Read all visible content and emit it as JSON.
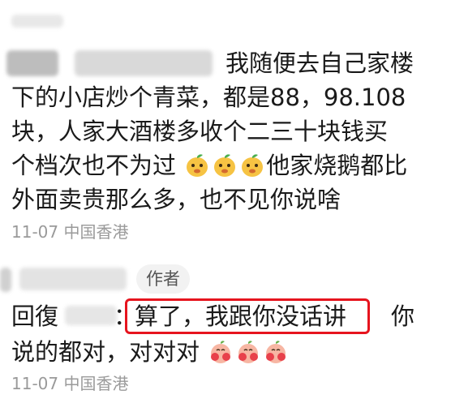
{
  "comment1": {
    "lines": [
      "我随便去自己家楼",
      "下的小店炒个青菜，都是88，98.108",
      "块，人家大酒楼多收个二三十块钱买",
      "个档次也不为过",
      "他家烧鹅都比",
      "外面卖贵那么多，也不见你说啥"
    ],
    "emoji_name": "mango-face-emoji",
    "emoji_count": 3,
    "timestamp": "11-07 中国香港"
  },
  "comment2": {
    "author_tag": "作者",
    "reply_prefix": "回復",
    "colon": "：",
    "highlighted_text": "算了，我跟你没话讲",
    "line1_tail": "你",
    "line2": "说的都对，对对对",
    "emoji_name": "peach-face-emoji",
    "emoji_count": 3,
    "timestamp": "11-07 中国香港"
  },
  "colors": {
    "highlight_border": "#e6141e",
    "meta_text": "#9a9a9a",
    "tag_bg": "#f2f2f2"
  }
}
